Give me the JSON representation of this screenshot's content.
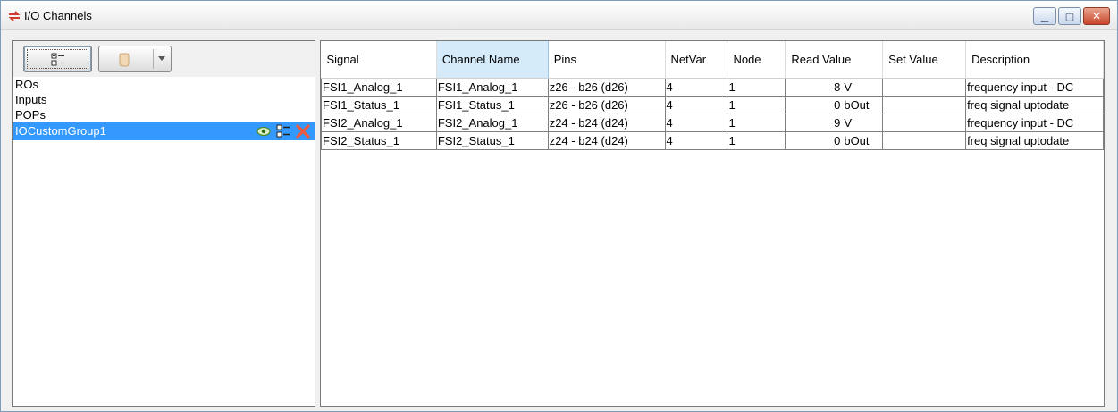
{
  "window": {
    "title": "I/O Channels",
    "buttons": {
      "minimize_icon": "minimize-icon",
      "maximize_icon": "maximize-icon",
      "close_icon": "close-icon"
    }
  },
  "left_panel": {
    "toolbar": {
      "tree_button_icon": "tree-view-icon",
      "hand_button_icon": "hand-icon"
    },
    "groups": [
      {
        "label": "ROs"
      },
      {
        "label": "Inputs"
      },
      {
        "label": "POPs"
      },
      {
        "label": "IOCustomGroup1",
        "selected": true
      }
    ]
  },
  "table": {
    "columns": [
      "Signal",
      "Channel Name",
      "Pins",
      "NetVar",
      "Node",
      "Read Value",
      "Set Value",
      "Description"
    ],
    "active_column": "Channel Name",
    "rows": [
      {
        "signal": "FSI1_Analog_1",
        "channel": "FSI1_Analog_1",
        "pins": "z26 - b26 (d26)",
        "netvar": "4",
        "node": "1",
        "read_value": "8",
        "read_unit": "V",
        "set_value": "",
        "description": "frequency input - DC"
      },
      {
        "signal": "FSI1_Status_1",
        "channel": "FSI1_Status_1",
        "pins": "z26 - b26 (d26)",
        "netvar": "4",
        "node": "1",
        "read_value": "0",
        "read_unit": "bOut",
        "set_value": "",
        "description": "freq signal uptodate"
      },
      {
        "signal": "FSI2_Analog_1",
        "channel": "FSI2_Analog_1",
        "pins": "z24 - b24 (d24)",
        "netvar": "4",
        "node": "1",
        "read_value": "9",
        "read_unit": "V",
        "set_value": "",
        "description": "frequency input - DC"
      },
      {
        "signal": "FSI2_Status_1",
        "channel": "FSI2_Status_1",
        "pins": "z24 - b24 (d24)",
        "netvar": "4",
        "node": "1",
        "read_value": "0",
        "read_unit": "bOut",
        "set_value": "",
        "description": "freq signal uptodate"
      }
    ]
  },
  "colors": {
    "selection": "#3399ff",
    "active_header": "#d5ebfa",
    "close_button": "#c9452b"
  }
}
